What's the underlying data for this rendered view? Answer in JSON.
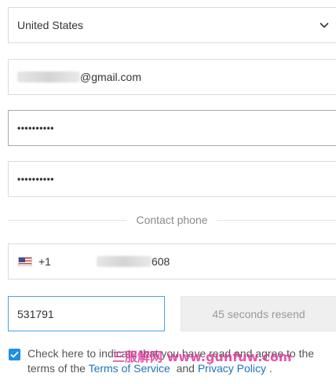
{
  "country": {
    "value": "United States"
  },
  "email": {
    "value_suffix": "@gmail.com"
  },
  "password": {
    "value": "••••••••••"
  },
  "confirm_password": {
    "value": "••••••••••"
  },
  "divider": {
    "label": "Contact phone"
  },
  "phone": {
    "flag_icon": "us-flag-icon",
    "dial_code": "+1",
    "value_suffix": "608"
  },
  "verification": {
    "code_value": "531791",
    "resend_label": "45 seconds resend"
  },
  "agreement": {
    "checked": true,
    "text_before": "Check here to indicate that you have read and agree to the terms of the",
    "terms_link": "Terms of Service",
    "text_and": "and",
    "privacy_link": "Privacy Policy",
    "text_end": "."
  },
  "watermark": {
    "text": "三服解网 www.gunfuw.com"
  },
  "colors": {
    "accent": "#1e8fe1",
    "link": "#1e73be",
    "watermark": "#e0309a",
    "border": "#dcdcdc"
  }
}
